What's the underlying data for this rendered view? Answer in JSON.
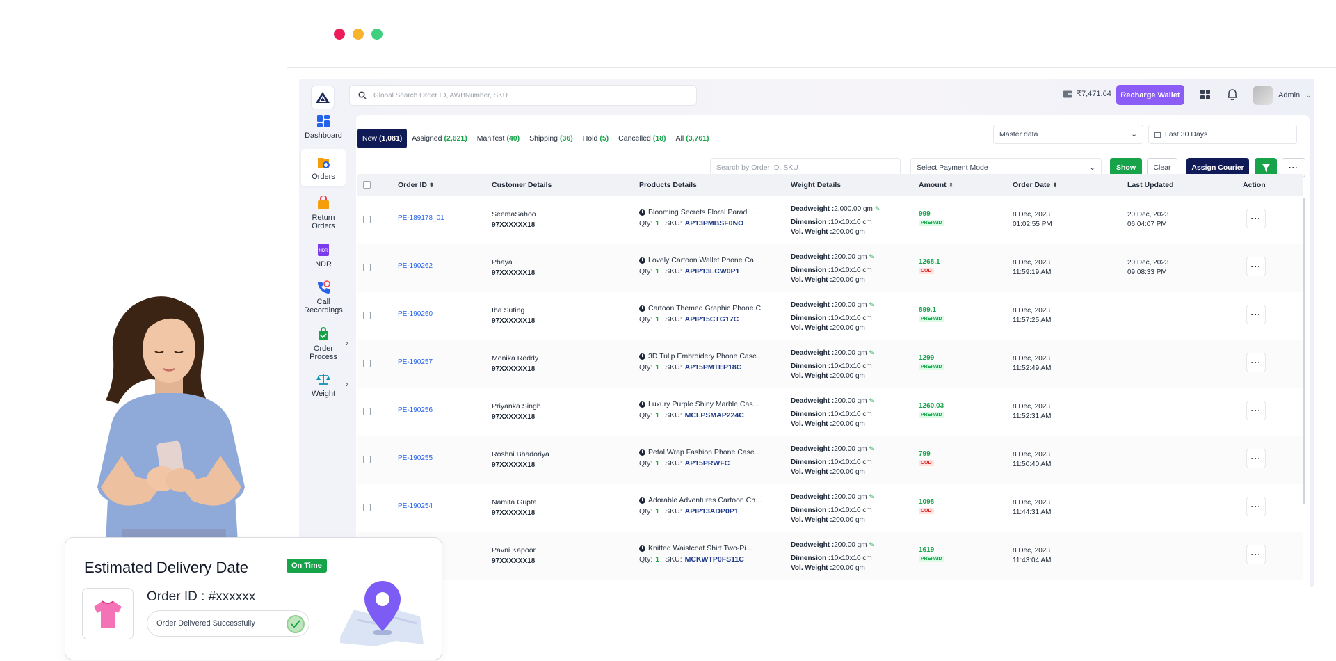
{
  "header": {
    "search_placeholder": "Global Search Order ID, AWBNumber, SKU",
    "wallet_balance": "₹7,471.64",
    "recharge_label": "Recharge Wallet",
    "user_label": "Admin"
  },
  "sidebar": {
    "items": [
      {
        "label": "Dashboard",
        "icon": "dashboard-icon"
      },
      {
        "label": "Orders",
        "icon": "orders-icon"
      },
      {
        "label": "Return Orders",
        "icon": "return-orders-icon"
      },
      {
        "label": "NDR",
        "icon": "ndr-icon"
      },
      {
        "label": "Call Recordings",
        "icon": "phone-icon"
      },
      {
        "label": "Order Process",
        "icon": "order-process-icon"
      },
      {
        "label": "Weight",
        "icon": "scale-icon"
      }
    ]
  },
  "tabs": [
    {
      "label": "New",
      "count": "(1,081)"
    },
    {
      "label": "Assigned",
      "count": "(2,621)"
    },
    {
      "label": "Manifest",
      "count": "(40)"
    },
    {
      "label": "Shipping",
      "count": "(36)"
    },
    {
      "label": "Hold",
      "count": "(5)"
    },
    {
      "label": "Cancelled",
      "count": "(18)"
    },
    {
      "label": "All",
      "count": "(3,761)"
    }
  ],
  "filters": {
    "master_select": "Master data",
    "date_range": "Last 30 Days",
    "order_search_placeholder": "Search by Order ID, SKU",
    "payment_select": "Select Payment Mode",
    "show_label": "Show",
    "clear_label": "Clear",
    "assign_label": "Assign Courier"
  },
  "table": {
    "columns": [
      "Order ID",
      "Customer Details",
      "Products Details",
      "Weight Details",
      "Amount",
      "Order Date",
      "Last Updated",
      "Action"
    ],
    "rows": [
      {
        "order_id": "PE-189178_01",
        "customer": "SeemaSahoo",
        "phone": "97XXXXXX18",
        "product": "Blooming Secrets Floral Paradi...",
        "qty": "1",
        "sku": "AP13PMBSF0NO",
        "deadweight": "2,000.00 gm",
        "dimension": "10x10x10 cm",
        "volweight": "200.00 gm",
        "amount": "999",
        "payment": "PREPAID",
        "date": "8 Dec, 2023",
        "time": "01:02:55 PM",
        "upd_date": "20 Dec, 2023",
        "upd_time": "06:04:07 PM"
      },
      {
        "order_id": "PE-190262",
        "customer": "Phaya .",
        "phone": "97XXXXXX18",
        "product": "Lovely Cartoon Wallet Phone Ca...",
        "qty": "1",
        "sku": "APIP13LCW0P1",
        "deadweight": "200.00 gm",
        "dimension": "10x10x10 cm",
        "volweight": "200.00 gm",
        "amount": "1268.1",
        "payment": "COD",
        "date": "8 Dec, 2023",
        "time": "11:59:19 AM",
        "upd_date": "20 Dec, 2023",
        "upd_time": "09:08:33 PM"
      },
      {
        "order_id": "PE-190260",
        "customer": "Iba Suting",
        "phone": "97XXXXXX18",
        "product": "Cartoon Themed Graphic Phone C...",
        "qty": "1",
        "sku": "APIP15CTG17C",
        "deadweight": "200.00 gm",
        "dimension": "10x10x10 cm",
        "volweight": "200.00 gm",
        "amount": "899.1",
        "payment": "PREPAID",
        "date": "8 Dec, 2023",
        "time": "11:57:25 AM",
        "upd_date": "",
        "upd_time": ""
      },
      {
        "order_id": "PE-190257",
        "customer": "Monika Reddy",
        "phone": "97XXXXXX18",
        "product": "3D Tulip Embroidery Phone Case...",
        "qty": "1",
        "sku": "AP15PMTEP18C",
        "deadweight": "200.00 gm",
        "dimension": "10x10x10 cm",
        "volweight": "200.00 gm",
        "amount": "1299",
        "payment": "PREPAID",
        "date": "8 Dec, 2023",
        "time": "11:52:49 AM",
        "upd_date": "",
        "upd_time": ""
      },
      {
        "order_id": "PE-190256",
        "customer": "Priyanka Singh",
        "phone": "97XXXXXX18",
        "product": "Luxury Purple Shiny Marble Cas...",
        "qty": "1",
        "sku": "MCLPSMAP224C",
        "deadweight": "200.00 gm",
        "dimension": "10x10x10 cm",
        "volweight": "200.00 gm",
        "amount": "1260.03",
        "payment": "PREPAID",
        "date": "8 Dec, 2023",
        "time": "11:52:31 AM",
        "upd_date": "",
        "upd_time": ""
      },
      {
        "order_id": "PE-190255",
        "customer": "Roshni Bhadoriya",
        "phone": "97XXXXXX18",
        "product": "Petal Wrap Fashion Phone Case...",
        "qty": "1",
        "sku": "AP15PRWFC",
        "deadweight": "200.00 gm",
        "dimension": "10x10x10 cm",
        "volweight": "200.00 gm",
        "amount": "799",
        "payment": "COD",
        "date": "8 Dec, 2023",
        "time": "11:50:40 AM",
        "upd_date": "",
        "upd_time": ""
      },
      {
        "order_id": "PE-190254",
        "customer": "Namita Gupta",
        "phone": "97XXXXXX18",
        "product": "Adorable Adventures Cartoon Ch...",
        "qty": "1",
        "sku": "APIP13ADP0P1",
        "deadweight": "200.00 gm",
        "dimension": "10x10x10 cm",
        "volweight": "200.00 gm",
        "amount": "1098",
        "payment": "COD",
        "date": "8 Dec, 2023",
        "time": "11:44:31 AM",
        "upd_date": "",
        "upd_time": ""
      },
      {
        "order_id": "",
        "customer": "Pavni Kapoor",
        "phone": "97XXXXXX18",
        "product": "Knitted Waistcoat Shirt Two-Pi...",
        "qty": "1",
        "sku": "MCKWTP0FS11C",
        "deadweight": "200.00 gm",
        "dimension": "10x10x10 cm",
        "volweight": "200.00 gm",
        "amount": "1619",
        "payment": "PREPAID",
        "date": "8 Dec, 2023",
        "time": "11:43:04 AM",
        "upd_date": "",
        "upd_time": ""
      }
    ],
    "labels": {
      "qty": "Qty:",
      "sku": "SKU:",
      "deadweight": "Deadweight :",
      "dimension": "Dimension :",
      "volweight": "Vol. Weight :"
    }
  },
  "delivery_card": {
    "title": "Estimated Delivery Date",
    "badge": "On Time",
    "order_id": "Order ID : #xxxxxx",
    "status": "Order Delivered Successfully"
  },
  "colors": {
    "accent_purple": "#8b5cf6",
    "navy": "#101a56",
    "green": "#16a34a",
    "dot_red": "#ee1b5b",
    "dot_yellow": "#f7b32b",
    "dot_green": "#3fcf7f"
  }
}
